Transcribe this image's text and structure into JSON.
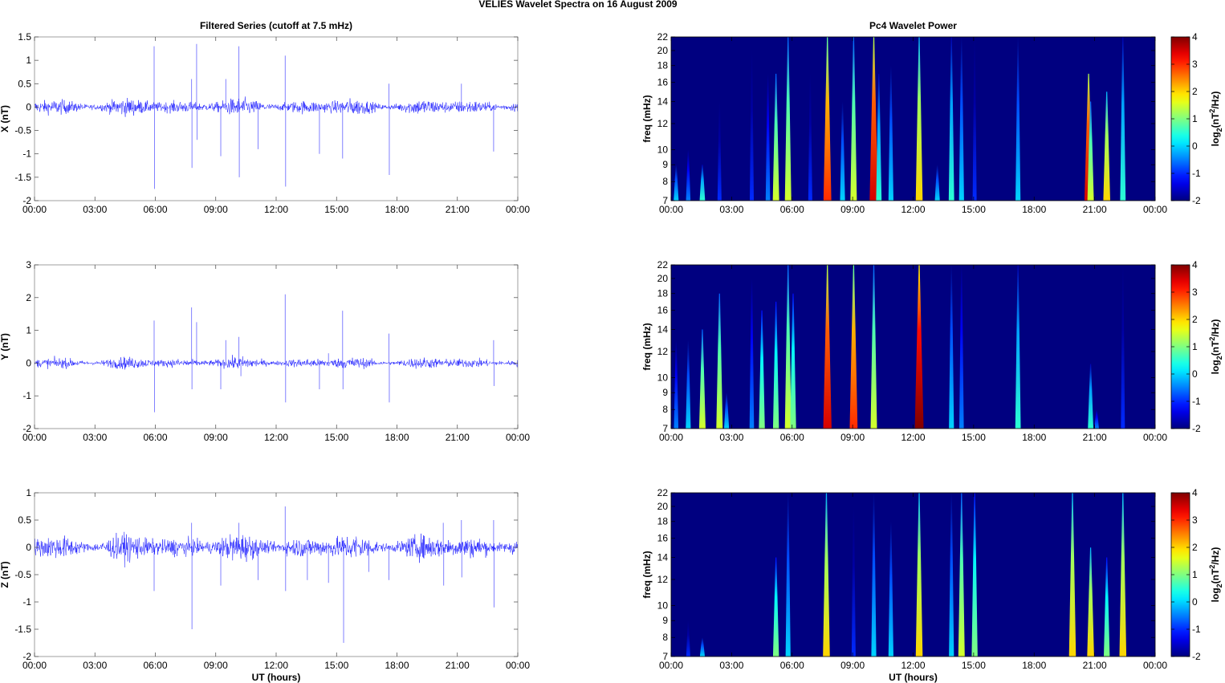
{
  "figure_title": "VELIES Wavelet Spectra on 16 August    2009",
  "chart_data": [
    {
      "type": "line",
      "title": "Filtered Series (cutoff at 7.5 mHz)",
      "ylabel": "X (nT)",
      "xlabel": "",
      "ylim": [
        -2,
        1.5
      ],
      "yticks": [
        "-2",
        "-1.5",
        "-1",
        "-0.5",
        "0",
        "0.5",
        "1",
        "1.5"
      ],
      "ytick_values": [
        -2,
        -1.5,
        -1,
        -0.5,
        0,
        0.5,
        1,
        1.5
      ],
      "xlim_hours": [
        0,
        24
      ],
      "xticks": [
        "00:00",
        "03:00",
        "06:00",
        "09:00",
        "12:00",
        "15:00",
        "18:00",
        "21:00",
        "00:00"
      ],
      "color": "#0000ff",
      "noise_amplitude": 0.15,
      "spikes": [
        [
          5.94,
          1.3
        ],
        [
          5.96,
          -1.75
        ],
        [
          7.8,
          0.6
        ],
        [
          7.82,
          -1.3
        ],
        [
          8.05,
          1.35
        ],
        [
          8.07,
          -0.7
        ],
        [
          9.25,
          -1.05
        ],
        [
          9.5,
          0.6
        ],
        [
          10.15,
          1.3
        ],
        [
          10.17,
          -1.5
        ],
        [
          11.1,
          -0.9
        ],
        [
          12.45,
          1.1
        ],
        [
          12.47,
          -1.7
        ],
        [
          14.15,
          -1.0
        ],
        [
          15.3,
          -1.1
        ],
        [
          17.6,
          0.5
        ],
        [
          17.62,
          -1.45
        ],
        [
          21.2,
          0.5
        ],
        [
          22.8,
          -0.95
        ]
      ]
    },
    {
      "type": "line",
      "title": "",
      "ylabel": "Y (nT)",
      "xlabel": "",
      "ylim": [
        -2,
        3
      ],
      "yticks": [
        "-2",
        "-1",
        "0",
        "1",
        "2",
        "3"
      ],
      "ytick_values": [
        -2,
        -1,
        0,
        1,
        2,
        3
      ],
      "xlim_hours": [
        0,
        24
      ],
      "xticks": [
        "00:00",
        "03:00",
        "06:00",
        "09:00",
        "12:00",
        "15:00",
        "18:00",
        "21:00",
        "00:00"
      ],
      "color": "#0000ff",
      "noise_amplitude": 0.15,
      "spikes": [
        [
          5.94,
          1.3
        ],
        [
          5.96,
          -1.5
        ],
        [
          7.8,
          1.7
        ],
        [
          7.82,
          -0.8
        ],
        [
          8.05,
          1.25
        ],
        [
          9.25,
          -0.8
        ],
        [
          9.5,
          0.7
        ],
        [
          10.15,
          0.8
        ],
        [
          10.25,
          -0.4
        ],
        [
          12.45,
          2.1
        ],
        [
          12.47,
          -1.2
        ],
        [
          14.15,
          -0.8
        ],
        [
          14.6,
          0.3
        ],
        [
          15.3,
          1.6
        ],
        [
          15.32,
          -0.8
        ],
        [
          17.6,
          0.9
        ],
        [
          17.62,
          -1.2
        ],
        [
          22.8,
          0.7
        ],
        [
          22.82,
          -0.7
        ]
      ]
    },
    {
      "type": "line",
      "title": "",
      "ylabel": "Z (nT)",
      "xlabel": "UT (hours)",
      "ylim": [
        -2,
        1
      ],
      "yticks": [
        "-2",
        "-1.5",
        "-1",
        "-0.5",
        "0",
        "0.5",
        "1"
      ],
      "ytick_values": [
        -2,
        -1.5,
        -1,
        -0.5,
        0,
        0.5,
        1
      ],
      "xlim_hours": [
        0,
        24
      ],
      "xticks": [
        "00:00",
        "03:00",
        "06:00",
        "09:00",
        "12:00",
        "15:00",
        "18:00",
        "21:00",
        "00:00"
      ],
      "color": "#0000ff",
      "noise_amplitude": 0.2,
      "spikes": [
        [
          5.94,
          -0.8
        ],
        [
          7.8,
          0.45
        ],
        [
          7.82,
          -1.5
        ],
        [
          9.25,
          -0.7
        ],
        [
          10.15,
          0.45
        ],
        [
          11.1,
          -0.6
        ],
        [
          12.45,
          0.75
        ],
        [
          12.47,
          -0.8
        ],
        [
          13.55,
          -0.6
        ],
        [
          14.6,
          -0.65
        ],
        [
          15.35,
          -1.75
        ],
        [
          16.6,
          -0.45
        ],
        [
          17.6,
          -0.6
        ],
        [
          20.3,
          0.45
        ],
        [
          20.32,
          -0.7
        ],
        [
          21.2,
          0.5
        ],
        [
          21.22,
          -0.55
        ],
        [
          22.8,
          0.5
        ],
        [
          22.82,
          -1.1
        ]
      ]
    },
    {
      "type": "heatmap",
      "title": "Pc4 Wavelet Power",
      "ylabel": "freq (mHz)",
      "xlabel": "",
      "ylim": [
        7,
        22
      ],
      "yscale": "log",
      "yticks": [
        "7",
        "8",
        "9",
        "10",
        "12",
        "14",
        "16",
        "18",
        "20",
        "22"
      ],
      "ytick_values": [
        7,
        8,
        9,
        10,
        12,
        14,
        16,
        18,
        20,
        22
      ],
      "xlim_hours": [
        0,
        24
      ],
      "xticks": [
        "00:00",
        "03:00",
        "06:00",
        "09:00",
        "12:00",
        "15:00",
        "18:00",
        "21:00",
        "00:00"
      ],
      "colorbar": {
        "range": [
          -2,
          4
        ],
        "ticks": [
          "-2",
          "-1",
          "0",
          "1",
          "2",
          "3",
          "4"
        ],
        "tick_values": [
          -2,
          -1,
          0,
          1,
          2,
          3,
          4
        ],
        "label_parts": [
          "log",
          "2",
          "(nT",
          "2",
          "/Hz)"
        ]
      },
      "background_power": -2,
      "streaks": [
        [
          0.25,
          9,
          0
        ],
        [
          0.85,
          10,
          -0.5
        ],
        [
          1.55,
          9,
          0.5
        ],
        [
          2.4,
          14,
          -1
        ],
        [
          4.0,
          20,
          -1
        ],
        [
          4.8,
          17,
          -0.5
        ],
        [
          5.2,
          17,
          1.5
        ],
        [
          5.8,
          22,
          1.5
        ],
        [
          6.9,
          17,
          -1
        ],
        [
          7.75,
          22,
          3
        ],
        [
          8.5,
          14,
          0
        ],
        [
          9.05,
          22,
          1.5
        ],
        [
          10.05,
          22,
          3.5
        ],
        [
          10.3,
          17,
          0.5
        ],
        [
          10.9,
          18,
          0
        ],
        [
          12.3,
          22,
          2
        ],
        [
          13.2,
          9,
          0
        ],
        [
          13.9,
          22,
          0.5
        ],
        [
          14.4,
          22,
          0
        ],
        [
          15.05,
          22,
          -1
        ],
        [
          17.2,
          22,
          0
        ],
        [
          20.7,
          17,
          3.5
        ],
        [
          20.8,
          14,
          1.5
        ],
        [
          21.6,
          15,
          2
        ],
        [
          22.4,
          22,
          0.5
        ]
      ]
    },
    {
      "type": "heatmap",
      "title": "",
      "ylabel": "freq (mHz)",
      "xlabel": "",
      "ylim": [
        7,
        22
      ],
      "yscale": "log",
      "yticks": [
        "7",
        "8",
        "9",
        "10",
        "12",
        "14",
        "16",
        "18",
        "20",
        "22"
      ],
      "ytick_values": [
        7,
        8,
        9,
        10,
        12,
        14,
        16,
        18,
        20,
        22
      ],
      "xlim_hours": [
        0,
        24
      ],
      "xticks": [
        "00:00",
        "03:00",
        "06:00",
        "09:00",
        "12:00",
        "15:00",
        "18:00",
        "21:00",
        "00:00"
      ],
      "colorbar": {
        "range": [
          -2,
          4
        ],
        "ticks": [
          "-2",
          "-1",
          "0",
          "1",
          "2",
          "3",
          "4"
        ],
        "tick_values": [
          -2,
          -1,
          0,
          1,
          2,
          3,
          4
        ],
        "label_parts": [
          "log",
          "2",
          "(nT",
          "2",
          "/Hz)"
        ]
      },
      "background_power": -2,
      "streaks": [
        [
          0.25,
          13,
          -0.5
        ],
        [
          0.85,
          13,
          0
        ],
        [
          1.55,
          14,
          1.5
        ],
        [
          2.4,
          18,
          1.5
        ],
        [
          2.75,
          9,
          0
        ],
        [
          4.0,
          20,
          -0.5
        ],
        [
          4.5,
          16,
          1
        ],
        [
          5.2,
          17,
          1
        ],
        [
          5.8,
          22,
          1.5
        ],
        [
          6.05,
          18,
          1
        ],
        [
          7.75,
          22,
          3.5
        ],
        [
          9.05,
          22,
          3
        ],
        [
          10.05,
          22,
          1.5
        ],
        [
          12.3,
          22,
          4
        ],
        [
          13.9,
          22,
          0
        ],
        [
          14.4,
          22,
          -0.5
        ],
        [
          17.2,
          22,
          0.5
        ],
        [
          20.8,
          11,
          0.5
        ],
        [
          21.1,
          8,
          -0.5
        ],
        [
          22.4,
          22,
          -1
        ]
      ]
    },
    {
      "type": "heatmap",
      "title": "",
      "ylabel": "freq (mHz)",
      "xlabel": "UT (hours)",
      "ylim": [
        7,
        22
      ],
      "yscale": "log",
      "yticks": [
        "7",
        "8",
        "9",
        "10",
        "12",
        "14",
        "16",
        "18",
        "20",
        "22"
      ],
      "ytick_values": [
        7,
        8,
        9,
        10,
        12,
        14,
        16,
        18,
        20,
        22
      ],
      "xlim_hours": [
        0,
        24
      ],
      "xticks": [
        "00:00",
        "03:00",
        "06:00",
        "09:00",
        "12:00",
        "15:00",
        "18:00",
        "21:00",
        "00:00"
      ],
      "colorbar": {
        "range": [
          -2,
          4
        ],
        "ticks": [
          "-2",
          "-1",
          "0",
          "1",
          "2",
          "3",
          "4"
        ],
        "tick_values": [
          -2,
          -1,
          0,
          1,
          2,
          3,
          4
        ],
        "label_parts": [
          "log",
          "2",
          "(nT",
          "2",
          "/Hz)"
        ]
      },
      "background_power": -2,
      "streaks": [
        [
          0.85,
          9,
          -1
        ],
        [
          1.55,
          8,
          0
        ],
        [
          5.2,
          14,
          1
        ],
        [
          5.8,
          22,
          0
        ],
        [
          7.7,
          22,
          2
        ],
        [
          9.05,
          20,
          -1
        ],
        [
          10.05,
          22,
          0
        ],
        [
          10.9,
          18,
          0
        ],
        [
          12.3,
          22,
          2
        ],
        [
          13.9,
          22,
          0
        ],
        [
          14.4,
          22,
          1.5
        ],
        [
          15.05,
          22,
          1
        ],
        [
          19.9,
          22,
          2
        ],
        [
          20.8,
          15,
          2
        ],
        [
          21.6,
          14,
          1
        ],
        [
          22.4,
          22,
          2
        ]
      ]
    }
  ]
}
